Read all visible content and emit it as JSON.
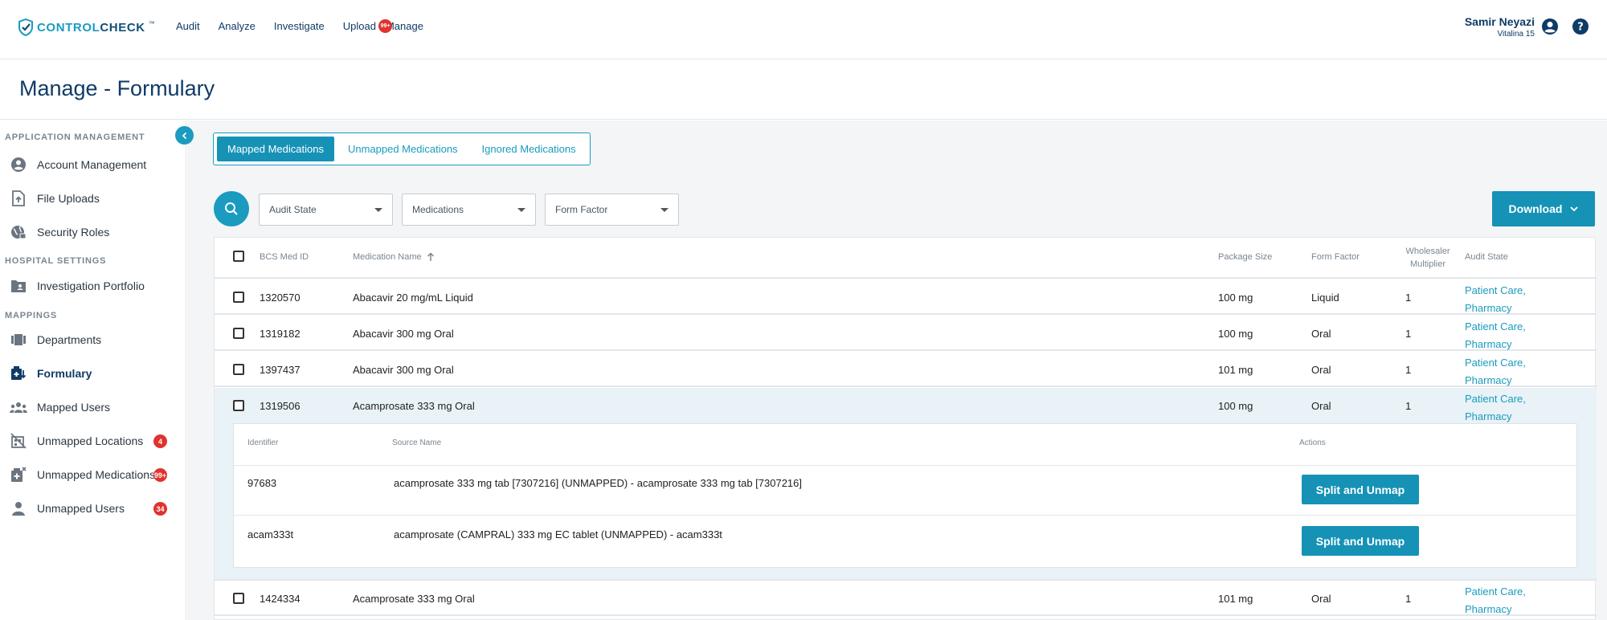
{
  "brand": {
    "name_light": "CONTROL",
    "name_bold": "CHECK",
    "tm": "™"
  },
  "nav": {
    "items": [
      "Audit",
      "Analyze",
      "Investigate",
      "Upload",
      "Manage"
    ],
    "manage_badge": "99+"
  },
  "user": {
    "name": "Samir Neyazi",
    "subtitle": "Vitalina 15"
  },
  "page": {
    "title": "Manage - Formulary"
  },
  "sidebar": {
    "sections": {
      "app": "APPLICATION MANAGEMENT",
      "hospital": "HOSPITAL SETTINGS",
      "mappings": "MAPPINGS"
    },
    "items": {
      "account": "Account Management",
      "uploads": "File Uploads",
      "security": "Security Roles",
      "portfolio": "Investigation Portfolio",
      "departments": "Departments",
      "formulary": "Formulary",
      "mapped_users": "Mapped Users",
      "unmapped_locations": "Unmapped Locations",
      "unmapped_medications": "Unmapped Medications",
      "unmapped_users": "Unmapped Users"
    },
    "badges": {
      "unmapped_locations": "4",
      "unmapped_medications": "99+",
      "unmapped_users": "34"
    }
  },
  "tabs": [
    "Mapped Medications",
    "Unmapped Medications",
    "Ignored Medications"
  ],
  "filters": {
    "audit_state": "Audit State",
    "medications": "Medications",
    "form_factor": "Form Factor",
    "download": "Download"
  },
  "table": {
    "headers": {
      "id": "BCS Med ID",
      "name": "Medication Name",
      "package": "Package Size",
      "form": "Form Factor",
      "multiplier_line1": "Wholesaler",
      "multiplier_line2": "Multiplier",
      "audit": "Audit State"
    },
    "rows": [
      {
        "id": "1320570",
        "name": "Abacavir 20 mg/mL Liquid",
        "package": "100 mg",
        "form": "Liquid",
        "multiplier": "1",
        "audit1": "Patient Care,",
        "audit2": "Pharmacy"
      },
      {
        "id": "1319182",
        "name": "Abacavir 300 mg Oral",
        "package": "100 mg",
        "form": "Oral",
        "multiplier": "1",
        "audit1": "Patient Care,",
        "audit2": "Pharmacy"
      },
      {
        "id": "1397437",
        "name": "Abacavir 300 mg Oral",
        "package": "101 mg",
        "form": "Oral",
        "multiplier": "1",
        "audit1": "Patient Care,",
        "audit2": "Pharmacy"
      },
      {
        "id": "1319506",
        "name": "Acamprosate 333 mg Oral",
        "package": "100 mg",
        "form": "Oral",
        "multiplier": "1",
        "audit1": "Patient Care,",
        "audit2": "Pharmacy"
      },
      {
        "id": "1424334",
        "name": "Acamprosate 333 mg Oral",
        "package": "101 mg",
        "form": "Oral",
        "multiplier": "1",
        "audit1": "Patient Care,",
        "audit2": "Pharmacy"
      }
    ],
    "subtable": {
      "headers": {
        "identifier": "Identifier",
        "source": "Source Name",
        "actions": "Actions"
      },
      "rows": [
        {
          "identifier": "97683",
          "source": "acamprosate 333 mg tab [7307216] (UNMAPPED) - acamprosate 333 mg tab [7307216]",
          "action": "Split and Unmap"
        },
        {
          "identifier": "acam333t",
          "source": "acamprosate (CAMPRAL) 333 mg EC tablet (UNMAPPED) - acam333t",
          "action": "Split and Unmap"
        }
      ]
    }
  }
}
